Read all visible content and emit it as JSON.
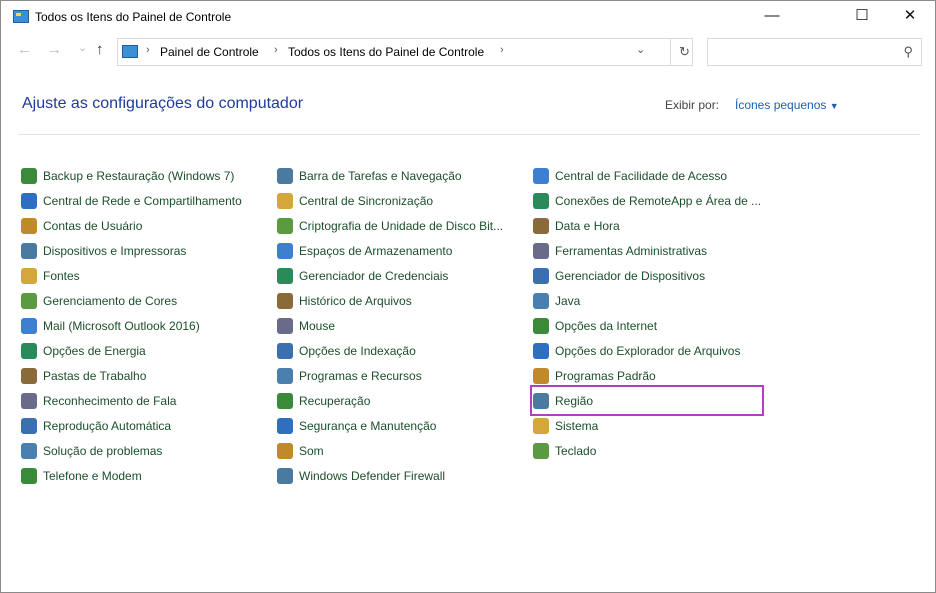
{
  "window": {
    "title": "Todos os Itens do Painel de Controle",
    "minimize": "—",
    "maximize": "☐",
    "close": "✕"
  },
  "nav": {
    "back": "←",
    "forward": "→",
    "recent": "⌄",
    "up": "↑",
    "dropdown": "⌄",
    "refresh": "↻",
    "search_icon": "⚲"
  },
  "breadcrumb": [
    "Painel de Controle",
    "Todos os Itens do Painel de Controle"
  ],
  "search": {
    "placeholder": ""
  },
  "heading": "Ajuste as configurações do computador",
  "view_by": {
    "label": "Exibir por:",
    "value": "Ícones pequenos"
  },
  "columns": [
    [
      "Backup e Restauração (Windows 7)",
      "Central de Rede e Compartilhamento",
      "Contas de Usuário",
      "Dispositivos e Impressoras",
      "Fontes",
      "Gerenciamento de Cores",
      "Mail (Microsoft Outlook 2016)",
      "Opções de Energia",
      "Pastas de Trabalho",
      "Reconhecimento de Fala",
      "Reprodução Automática",
      "Solução de problemas",
      "Telefone e Modem"
    ],
    [
      "Barra de Tarefas e Navegação",
      "Central de Sincronização",
      "Criptografia de Unidade de Disco Bit...",
      "Espaços de Armazenamento",
      "Gerenciador de Credenciais",
      "Histórico de Arquivos",
      "Mouse",
      "Opções de Indexação",
      "Programas e Recursos",
      "Recuperação",
      "Segurança e Manutenção",
      "Som",
      "Windows Defender Firewall"
    ],
    [
      "Central de Facilidade de Acesso",
      "Conexões de RemoteApp e Área de ...",
      "Data e Hora",
      "Ferramentas Administrativas",
      "Gerenciador de Dispositivos",
      "Java",
      "Opções da Internet",
      "Opções do Explorador de Arquivos",
      "Programas Padrão",
      "Região",
      "Sistema",
      "Teclado"
    ]
  ],
  "highlighted": "Região"
}
